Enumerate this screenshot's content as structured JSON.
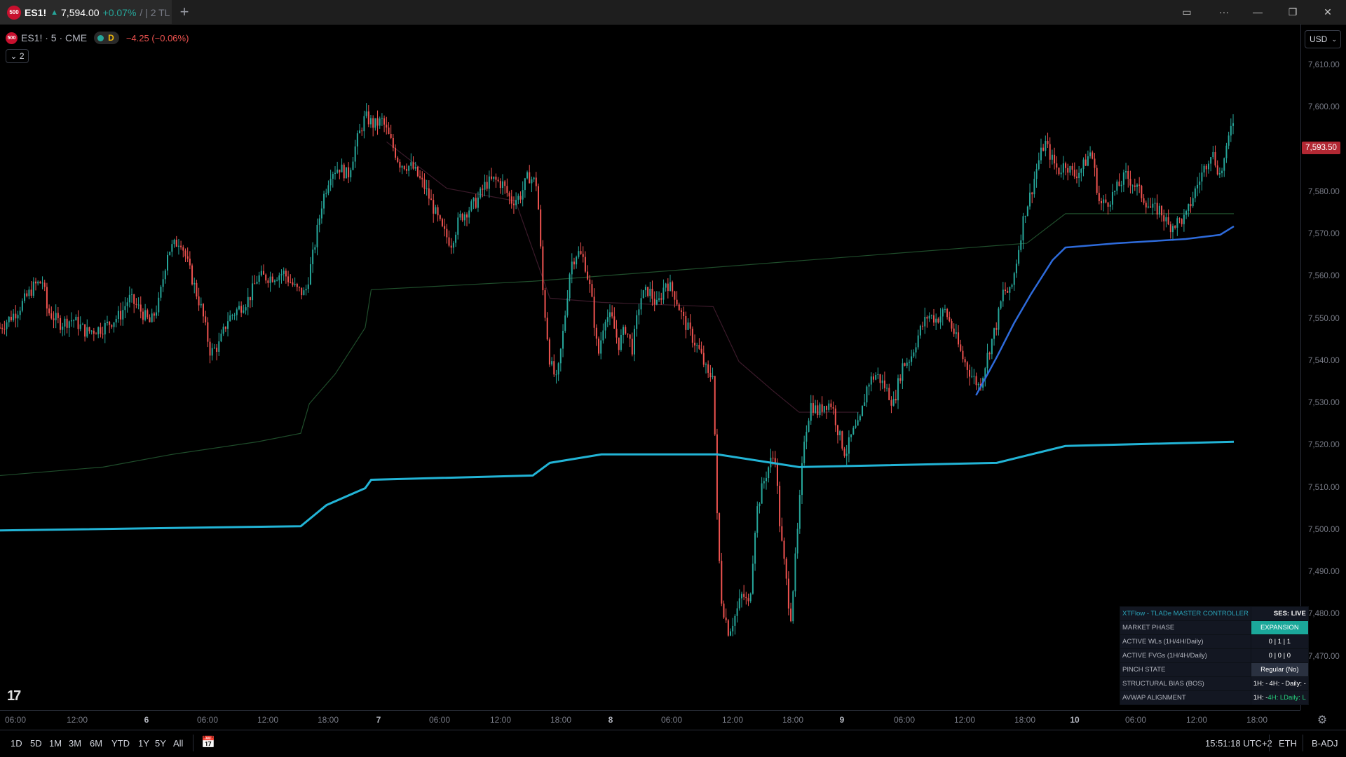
{
  "tab": {
    "logo_text": "500",
    "symbol": "ES1!",
    "arrow": "▲",
    "price": "7,594.00",
    "change": "+0.07%",
    "rest": "/ | 2 TL",
    "new_tab_glyph": "+"
  },
  "window": {
    "layout_glyph": "▭",
    "more_glyph": "···",
    "minimize_glyph": "—",
    "restore_glyph": "❐",
    "close_glyph": "✕"
  },
  "legend": {
    "logo_text": "500",
    "title": "ES1! · 5 · CME",
    "d_label": "D",
    "change": "−4.25 (−0.06%)",
    "indicator_count": "⌄ 2"
  },
  "price_axis": {
    "currency": "USD",
    "current_price": "7,593.50",
    "ticks": [
      {
        "label": "7,610.00",
        "value": 7610
      },
      {
        "label": "7,600.00",
        "value": 7600
      },
      {
        "label": "7,590.00",
        "value": 7590
      },
      {
        "label": "7,580.00",
        "value": 7580
      },
      {
        "label": "7,570.00",
        "value": 7570
      },
      {
        "label": "7,560.00",
        "value": 7560
      },
      {
        "label": "7,550.00",
        "value": 7550
      },
      {
        "label": "7,540.00",
        "value": 7540
      },
      {
        "label": "7,530.00",
        "value": 7530
      },
      {
        "label": "7,520.00",
        "value": 7520
      },
      {
        "label": "7,510.00",
        "value": 7510
      },
      {
        "label": "7,500.00",
        "value": 7500
      },
      {
        "label": "7,490.00",
        "value": 7490
      },
      {
        "label": "7,480.00",
        "value": 7480
      },
      {
        "label": "7,470.00",
        "value": 7470
      }
    ]
  },
  "time_axis": {
    "ticks": [
      {
        "label": "06:00",
        "bold": false
      },
      {
        "label": "12:00",
        "bold": false
      },
      {
        "label": "6",
        "bold": true
      },
      {
        "label": "06:00",
        "bold": false
      },
      {
        "label": "12:00",
        "bold": false
      },
      {
        "label": "18:00",
        "bold": false
      },
      {
        "label": "7",
        "bold": true
      },
      {
        "label": "06:00",
        "bold": false
      },
      {
        "label": "12:00",
        "bold": false
      },
      {
        "label": "18:00",
        "bold": false
      },
      {
        "label": "8",
        "bold": true
      },
      {
        "label": "06:00",
        "bold": false
      },
      {
        "label": "12:00",
        "bold": false
      },
      {
        "label": "18:00",
        "bold": false
      },
      {
        "label": "9",
        "bold": true
      },
      {
        "label": "06:00",
        "bold": false
      },
      {
        "label": "12:00",
        "bold": false
      },
      {
        "label": "18:00",
        "bold": false
      },
      {
        "label": "10",
        "bold": true
      },
      {
        "label": "06:00",
        "bold": false
      },
      {
        "label": "12:00",
        "bold": false
      },
      {
        "label": "18:00",
        "bold": false
      }
    ]
  },
  "bottom": {
    "ranges": [
      "1D",
      "5D",
      "1M",
      "3M",
      "6M",
      "YTD",
      "1Y",
      "5Y",
      "All"
    ],
    "clock": "15:51:18 UTC+2",
    "session": "ETH",
    "adjust": "B-ADJ"
  },
  "tv_logo": "17",
  "info_table": {
    "header_title": "XTFlow - TLADe MASTER CONTROLLER",
    "header_status": "SES: LIVE",
    "rows": [
      {
        "label": "MARKET PHASE",
        "value": "EXPANSION"
      },
      {
        "label": "ACTIVE WLs (1H/4H/Daily)",
        "value": "0 | 1 | 1"
      },
      {
        "label": "ACTIVE FVGs (1H/4H/Daily)",
        "value": "0 | 0 | 0"
      },
      {
        "label": "PINCH STATE",
        "value": "Regular (No)"
      },
      {
        "label": "STRUCTURAL BIAS (BOS)",
        "v1": "1H: -",
        "v2": "4H: -",
        "v3": "Daily: -"
      },
      {
        "label": "AVWAP ALIGNMENT",
        "v1": "1H: -",
        "v2": "4H: L",
        "v3": "Daily: L"
      }
    ]
  },
  "chart_data": {
    "type": "candlestick",
    "title": "ES1! · 5 · CME",
    "ylim": [
      7463,
      7619
    ],
    "y_ticks": [
      7470,
      7480,
      7490,
      7500,
      7510,
      7520,
      7530,
      7540,
      7550,
      7560,
      7570,
      7580,
      7590,
      7600,
      7610
    ],
    "current_price": 7593.5,
    "colors": {
      "up": "#26a69a",
      "down": "#ef5350",
      "cyan_vwap": "#22b4d6",
      "blue_vwap": "#2e6bdb",
      "green_band": "#1f4d2b",
      "maroon_band": "#3b1a2a"
    },
    "price_path": [
      [
        0,
        7548
      ],
      [
        20,
        7552
      ],
      [
        40,
        7558
      ],
      [
        50,
        7559
      ],
      [
        55,
        7552
      ],
      [
        70,
        7549
      ],
      [
        85,
        7550
      ],
      [
        100,
        7547
      ],
      [
        120,
        7548
      ],
      [
        140,
        7551
      ],
      [
        150,
        7555
      ],
      [
        160,
        7553
      ],
      [
        175,
        7549
      ],
      [
        185,
        7554
      ],
      [
        195,
        7566
      ],
      [
        210,
        7569
      ],
      [
        220,
        7562
      ],
      [
        235,
        7552
      ],
      [
        245,
        7542
      ],
      [
        255,
        7544
      ],
      [
        265,
        7550
      ],
      [
        275,
        7552
      ],
      [
        290,
        7555
      ],
      [
        300,
        7560
      ],
      [
        315,
        7560
      ],
      [
        330,
        7561
      ],
      [
        345,
        7557
      ],
      [
        355,
        7556
      ],
      [
        365,
        7566
      ],
      [
        375,
        7578
      ],
      [
        385,
        7585
      ],
      [
        395,
        7586
      ],
      [
        405,
        7584
      ],
      [
        415,
        7592
      ],
      [
        425,
        7598
      ],
      [
        435,
        7596
      ],
      [
        445,
        7597
      ],
      [
        455,
        7592
      ],
      [
        465,
        7587
      ],
      [
        480,
        7586
      ],
      [
        495,
        7581
      ],
      [
        505,
        7576
      ],
      [
        515,
        7571
      ],
      [
        525,
        7568
      ],
      [
        535,
        7574
      ],
      [
        545,
        7576
      ],
      [
        555,
        7578
      ],
      [
        565,
        7582
      ],
      [
        575,
        7583
      ],
      [
        585,
        7582
      ],
      [
        595,
        7578
      ],
      [
        605,
        7579
      ],
      [
        615,
        7584
      ],
      [
        625,
        7582
      ],
      [
        632,
        7556
      ],
      [
        640,
        7540
      ],
      [
        648,
        7535
      ],
      [
        656,
        7548
      ],
      [
        664,
        7563
      ],
      [
        672,
        7566
      ],
      [
        680,
        7564
      ],
      [
        688,
        7556
      ],
      [
        696,
        7541
      ],
      [
        704,
        7551
      ],
      [
        712,
        7550
      ],
      [
        720,
        7544
      ],
      [
        728,
        7548
      ],
      [
        736,
        7543
      ],
      [
        745,
        7555
      ],
      [
        755,
        7557
      ],
      [
        765,
        7553
      ],
      [
        775,
        7559
      ],
      [
        785,
        7556
      ],
      [
        795,
        7550
      ],
      [
        805,
        7546
      ],
      [
        815,
        7542
      ],
      [
        825,
        7536
      ],
      [
        830,
        7538
      ],
      [
        835,
        7500
      ],
      [
        840,
        7483
      ],
      [
        848,
        7476
      ],
      [
        856,
        7480
      ],
      [
        864,
        7485
      ],
      [
        872,
        7482
      ],
      [
        880,
        7504
      ],
      [
        888,
        7511
      ],
      [
        896,
        7516
      ],
      [
        902,
        7518
      ],
      [
        908,
        7500
      ],
      [
        914,
        7490
      ],
      [
        920,
        7479
      ],
      [
        928,
        7499
      ],
      [
        936,
        7522
      ],
      [
        944,
        7530
      ],
      [
        952,
        7528
      ],
      [
        960,
        7530
      ],
      [
        968,
        7530
      ],
      [
        976,
        7523
      ],
      [
        984,
        7518
      ],
      [
        992,
        7523
      ],
      [
        1000,
        7525
      ],
      [
        1010,
        7535
      ],
      [
        1020,
        7537
      ],
      [
        1030,
        7534
      ],
      [
        1040,
        7530
      ],
      [
        1050,
        7539
      ],
      [
        1060,
        7541
      ],
      [
        1070,
        7547
      ],
      [
        1080,
        7551
      ],
      [
        1090,
        7550
      ],
      [
        1100,
        7552
      ],
      [
        1110,
        7547
      ],
      [
        1120,
        7541
      ],
      [
        1130,
        7537
      ],
      [
        1140,
        7534
      ],
      [
        1150,
        7542
      ],
      [
        1160,
        7549
      ],
      [
        1168,
        7557
      ],
      [
        1176,
        7556
      ],
      [
        1184,
        7565
      ],
      [
        1192,
        7575
      ],
      [
        1200,
        7580
      ],
      [
        1208,
        7587
      ],
      [
        1216,
        7592
      ],
      [
        1224,
        7588
      ],
      [
        1232,
        7585
      ],
      [
        1240,
        7587
      ],
      [
        1250,
        7584
      ],
      [
        1260,
        7586
      ],
      [
        1270,
        7590
      ],
      [
        1280,
        7577
      ],
      [
        1290,
        7578
      ],
      [
        1300,
        7581
      ],
      [
        1310,
        7584
      ],
      [
        1320,
        7582
      ],
      [
        1330,
        7579
      ],
      [
        1340,
        7576
      ],
      [
        1350,
        7576
      ],
      [
        1360,
        7572
      ],
      [
        1370,
        7573
      ],
      [
        1380,
        7574
      ],
      [
        1390,
        7580
      ],
      [
        1400,
        7585
      ],
      [
        1410,
        7590
      ],
      [
        1420,
        7584
      ],
      [
        1428,
        7590
      ],
      [
        1433,
        7597
      ],
      [
        1436,
        7598
      ]
    ],
    "cyan_vwap": [
      [
        0,
        7500
      ],
      [
        350,
        7501
      ],
      [
        380,
        7506
      ],
      [
        425,
        7510
      ],
      [
        432,
        7512
      ],
      [
        620,
        7513
      ],
      [
        640,
        7516
      ],
      [
        700,
        7518
      ],
      [
        835,
        7518
      ],
      [
        930,
        7515
      ],
      [
        1160,
        7516
      ],
      [
        1240,
        7520
      ],
      [
        1436,
        7521
      ]
    ],
    "blue_vwap": [
      [
        1136,
        7532
      ],
      [
        1160,
        7541
      ],
      [
        1180,
        7549
      ],
      [
        1200,
        7556
      ],
      [
        1225,
        7564
      ],
      [
        1240,
        7567
      ],
      [
        1300,
        7568
      ],
      [
        1380,
        7569
      ],
      [
        1420,
        7570
      ],
      [
        1436,
        7572
      ]
    ],
    "green_band": [
      [
        0,
        7513
      ],
      [
        120,
        7515
      ],
      [
        200,
        7518
      ],
      [
        300,
        7521
      ],
      [
        350,
        7523
      ],
      [
        360,
        7530
      ],
      [
        390,
        7537
      ],
      [
        425,
        7548
      ],
      [
        432,
        7557
      ],
      [
        620,
        7559
      ],
      [
        1195,
        7568
      ],
      [
        1240,
        7575
      ],
      [
        1436,
        7575
      ]
    ],
    "maroon_band": [
      [
        450,
        7592
      ],
      [
        520,
        7581
      ],
      [
        600,
        7578
      ],
      [
        640,
        7555
      ],
      [
        700,
        7554
      ],
      [
        830,
        7553
      ],
      [
        860,
        7540
      ],
      [
        900,
        7533
      ],
      [
        930,
        7528
      ],
      [
        1000,
        7528
      ]
    ]
  }
}
